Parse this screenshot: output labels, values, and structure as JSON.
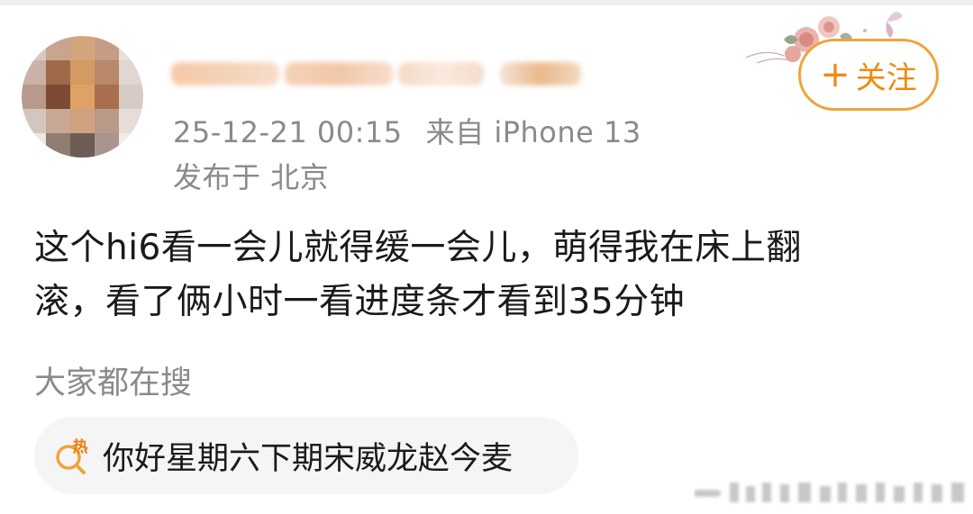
{
  "post": {
    "timestamp": "25-12-21 00:15",
    "source": "来自 iPhone 13",
    "location": "发布于 北京",
    "text_line1": "这个hi6看一会儿就得缓一会儿，萌得我在床上翻",
    "text_line2": "滚，看了俩小时一看进度条才看到35分钟"
  },
  "follow_button": {
    "plus": "+",
    "label": "关注"
  },
  "trending": {
    "section_label": "大家都在搜",
    "hot_badge": "热",
    "query": "你好星期六下期宋威龙赵今麦"
  },
  "colors": {
    "accent_orange": "#f0a33a",
    "follow_text": "#ee8a12",
    "meta_gray": "#8a8a8a",
    "body_text": "#1a1a1a",
    "chip_bg": "#f5f5f5"
  },
  "icons": {
    "avatar": "pixelated-avatar",
    "ornament": "flower-butterfly-ornament",
    "hot_search": "hot-search-icon"
  }
}
